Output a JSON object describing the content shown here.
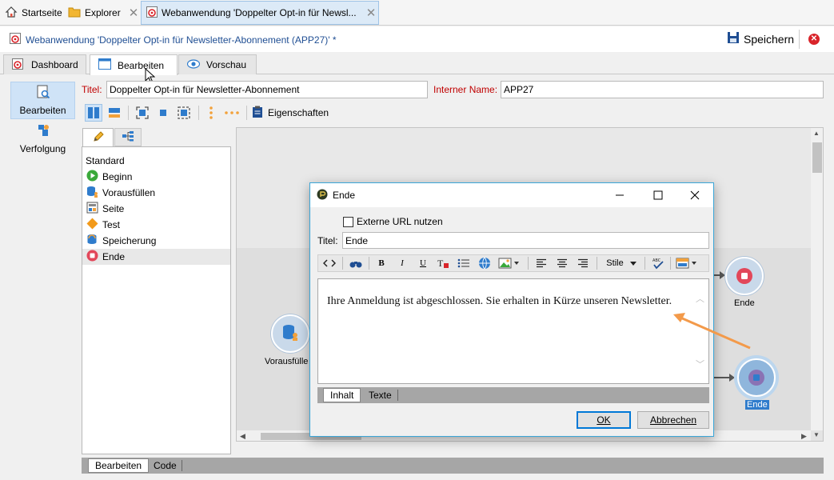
{
  "topnav": {
    "home_label": "Startseite",
    "explorer_label": "Explorer",
    "tab_label": "Webanwendung 'Doppelter Opt-in für Newsl...",
    "close_glyph": "✕"
  },
  "titlebar": {
    "title": "Webanwendung 'Doppelter Opt-in für Newsletter-Abonnement (APP27)' *",
    "save_label": "Speichern"
  },
  "tabs": [
    {
      "label": "Dashboard"
    },
    {
      "label": "Bearbeiten"
    },
    {
      "label": "Vorschau"
    }
  ],
  "sidenav": {
    "edit_label": "Bearbeiten",
    "tracking_label": "Verfolgung"
  },
  "form": {
    "title_label": "Titel:",
    "title_value": "Doppelter Opt-in für Newsletter-Abonnement",
    "internal_label": "Interner Name:",
    "internal_value": "APP27"
  },
  "toolbar": {
    "properties_label": "Eigenschaften"
  },
  "palette": {
    "items": [
      {
        "label": "Standard"
      },
      {
        "label": "Beginn"
      },
      {
        "label": "Vorausfüllen"
      },
      {
        "label": "Seite"
      },
      {
        "label": "Test"
      },
      {
        "label": "Speicherung"
      },
      {
        "label": "Ende"
      }
    ]
  },
  "canvas": {
    "node_prefill_label": "Vorausfülle",
    "node_end1_label": "Ende",
    "node_end2_label": "Ende"
  },
  "dialog": {
    "title": "Ende",
    "external_url_label": "Externe URL nutzen",
    "title_field_label": "Titel:",
    "title_field_value": "Ende",
    "styles_label": "Stile",
    "content_text": "Ihre Anmeldung ist abgeschlossen. Sie erhalten in Kürze unseren Newsletter.",
    "tab_content": "Inhalt",
    "tab_text": "Texte",
    "ok_label": "OK",
    "cancel_label": "Abbrechen"
  },
  "bottomtabs": {
    "edit": "Bearbeiten",
    "code": "Code"
  },
  "colors": {
    "accent": "#1f4e93",
    "highlight_arrow": "#f39a4a",
    "end_node": "#e2475a",
    "selected_node": "#2f8fd8"
  }
}
